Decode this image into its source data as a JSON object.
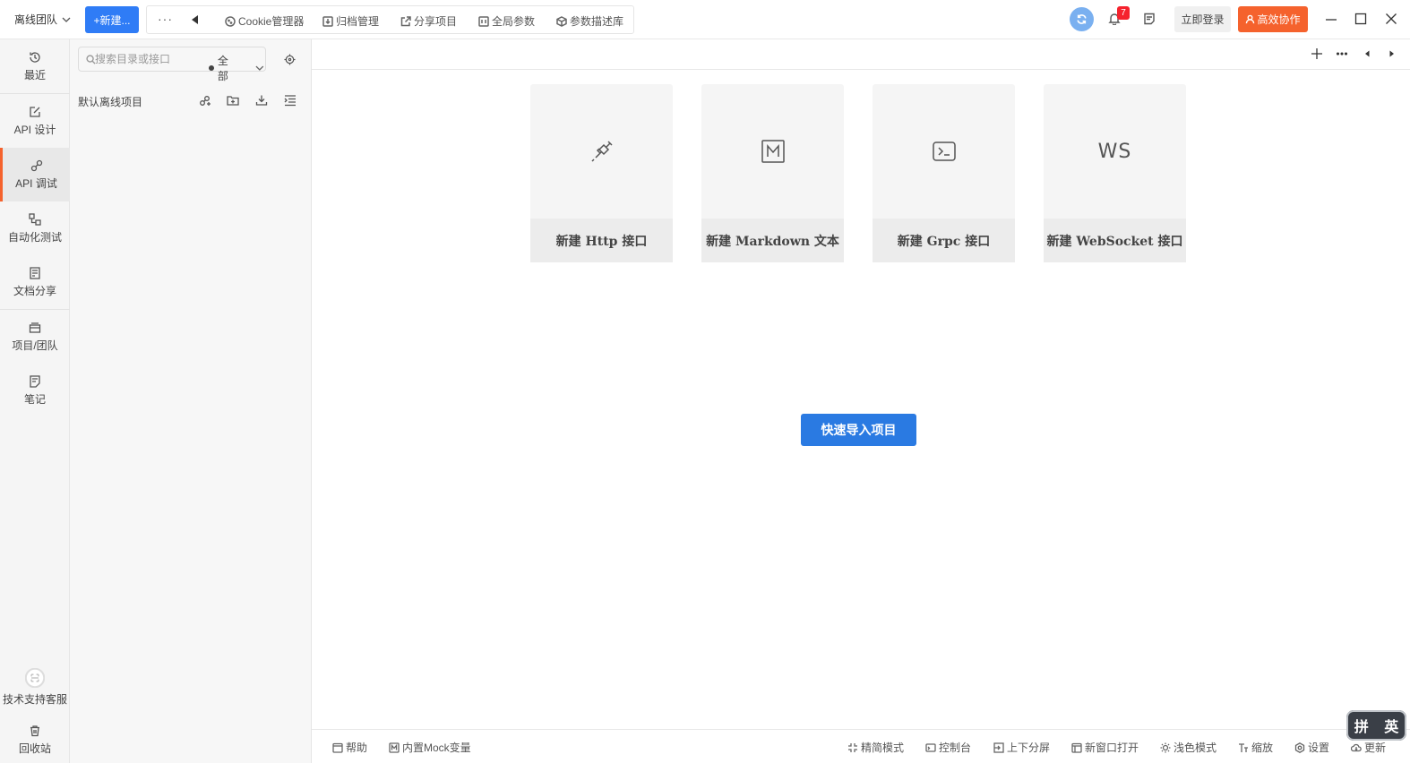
{
  "topbar": {
    "team_label": "离线团队",
    "new_button": "+新建...",
    "more": "···",
    "tools": [
      {
        "label": "Cookie管理器",
        "icon": "cookie-icon"
      },
      {
        "label": "归档管理",
        "icon": "archive-icon"
      },
      {
        "label": "分享项目",
        "icon": "share-icon"
      },
      {
        "label": "全局参数",
        "icon": "params-icon"
      },
      {
        "label": "参数描述库",
        "icon": "cube-icon"
      }
    ],
    "notification_count": "7",
    "login_button": "立即登录",
    "collab_button": "高效协作"
  },
  "leftnav": {
    "items": [
      {
        "label": "最近",
        "icon": "history-icon"
      },
      {
        "label": "API 设计",
        "icon": "edit-icon"
      },
      {
        "label": "API 调试",
        "icon": "link-icon"
      },
      {
        "label": "自动化测试",
        "icon": "flow-icon"
      },
      {
        "label": "文档分享",
        "icon": "doc-icon"
      },
      {
        "label": "项目/团队",
        "icon": "layers-icon"
      },
      {
        "label": "笔记",
        "icon": "note-icon"
      }
    ],
    "support": "技术支持客服",
    "trash": "回收站"
  },
  "tree": {
    "search_placeholder": "搜索目录或接口",
    "filter_value": "全部",
    "project_name": "默认离线项目"
  },
  "cards": [
    {
      "label": "新建 Http 接口",
      "icon": "plug-icon"
    },
    {
      "label": "新建 Markdown 文本",
      "icon": "markdown-icon"
    },
    {
      "label": "新建 Grpc 接口",
      "icon": "terminal-icon"
    },
    {
      "label": "新建 WebSocket 接口",
      "icon": "websocket-icon",
      "glyph": "WS"
    }
  ],
  "import_button": "快速导入项目",
  "bottombar": {
    "left": [
      {
        "label": "帮助",
        "icon": "help-icon"
      },
      {
        "label": "内置Mock变量",
        "icon": "mock-icon"
      }
    ],
    "right": [
      {
        "label": "精简模式",
        "icon": "compress-icon"
      },
      {
        "label": "控制台",
        "icon": "console-icon"
      },
      {
        "label": "上下分屏",
        "icon": "split-icon"
      },
      {
        "label": "新窗口打开",
        "icon": "window-icon"
      },
      {
        "label": "浅色模式",
        "icon": "sun-icon"
      },
      {
        "label": "缩放",
        "icon": "font-size-icon"
      },
      {
        "label": "设置",
        "icon": "settings-icon"
      },
      {
        "label": "更新",
        "icon": "cloud-icon"
      }
    ]
  },
  "ime": {
    "left": "拼",
    "right": "英"
  }
}
